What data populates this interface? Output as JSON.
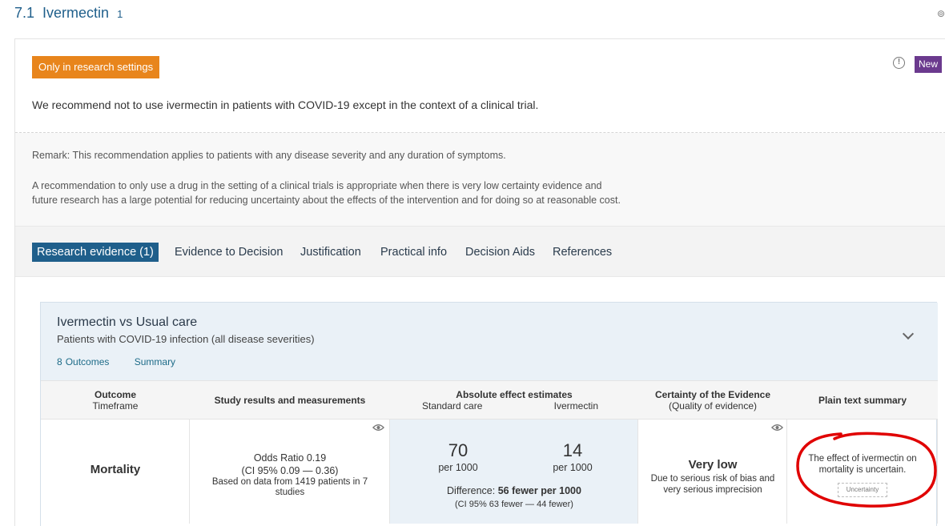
{
  "section": {
    "number": "7.1",
    "title": "Ivermectin",
    "count": "1"
  },
  "card": {
    "badge": "Only in research settings",
    "new_badge": "New",
    "info_icon": "info-icon",
    "recommendation": "We recommend not to use ivermectin in patients with COVID-19 except in the context of a clinical trial.",
    "remark1": "Remark: This recommendation applies to patients with any disease severity and any duration of symptoms.",
    "remark2_line1": "A recommendation to only use a drug in the setting of a clinical trials is appropriate when there is very low certainty evidence and",
    "remark2_line2": "future research has a large potential for reducing uncertainty about the effects of the intervention and for doing so at reasonable cost."
  },
  "tabs": [
    {
      "label": "Research evidence  (1)",
      "active": true
    },
    {
      "label": "Evidence to Decision",
      "active": false
    },
    {
      "label": "Justification",
      "active": false
    },
    {
      "label": "Practical info",
      "active": false
    },
    {
      "label": "Decision Aids",
      "active": false
    },
    {
      "label": "References",
      "active": false
    }
  ],
  "evidence": {
    "title": "Ivermectin vs Usual care",
    "subtitle": "Patients with COVID-19 infection (all disease severities)",
    "outcomes_count": "8",
    "outcomes_label": "Outcomes",
    "summary_label": "Summary",
    "columns": {
      "outcome": "Outcome",
      "timeframe": "Timeframe",
      "study": "Study results and measurements",
      "absolute": "Absolute effect estimates",
      "standard": "Standard care",
      "ivermectin": "Ivermectin",
      "certainty": "Certainty of the Evidence",
      "quality": "(Quality of evidence)",
      "plain": "Plain text summary"
    },
    "row": {
      "outcome": "Mortality",
      "odds_ratio": "Odds Ratio 0.19",
      "ci": "(CI 95% 0.09 — 0.36)",
      "based_on": "Based on data from 1419 patients in 7 studies",
      "standard_value": "70",
      "standard_unit": "per 1000",
      "ivermectin_value": "14",
      "ivermectin_unit": "per 1000",
      "difference_label": "Difference:",
      "difference_value": "56 fewer per 1000",
      "difference_ci": "(CI 95% 63 fewer — 44 fewer)",
      "certainty": "Very low",
      "certainty_reason": "Due to serious risk of bias and very serious imprecision",
      "plain_summary": "The effect of ivermectin on mortality is uncertain.",
      "uncertainty_badge": "Uncertainty"
    }
  },
  "colors": {
    "accent": "#1f5f8b",
    "orange_badge": "#e8851c",
    "new_badge": "#6b3a8e",
    "annotation": "#e00000"
  }
}
